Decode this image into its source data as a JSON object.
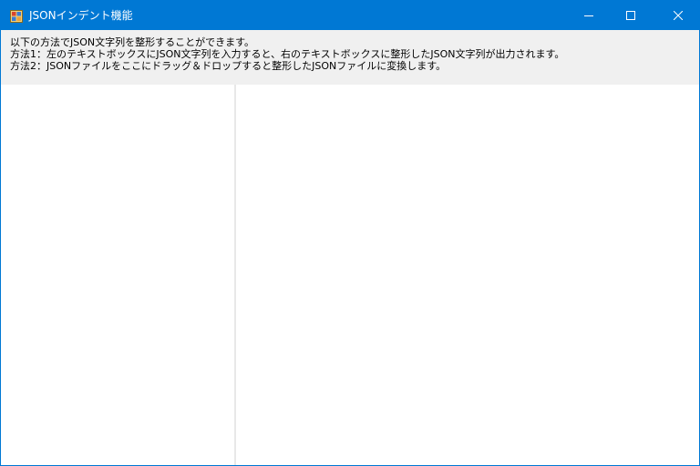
{
  "window": {
    "title": "JSONインデント機能",
    "accent_color": "#0078d4",
    "icons": {
      "app": "app-icon",
      "minimize": "minimize-icon",
      "maximize": "maximize-icon",
      "close": "close-icon"
    }
  },
  "instructions": {
    "line1": "以下の方法でJSON文字列を整形することができます。",
    "line2": "方法1：左のテキストボックスにJSON文字列を入力すると、右のテキストボックスに整形したJSON文字列が出力されます。",
    "line3": "方法2：JSONファイルをここにドラッグ＆ドロップすると整形したJSONファイルに変換します。"
  },
  "input_box": {
    "value": ""
  },
  "output_box": {
    "value": ""
  }
}
